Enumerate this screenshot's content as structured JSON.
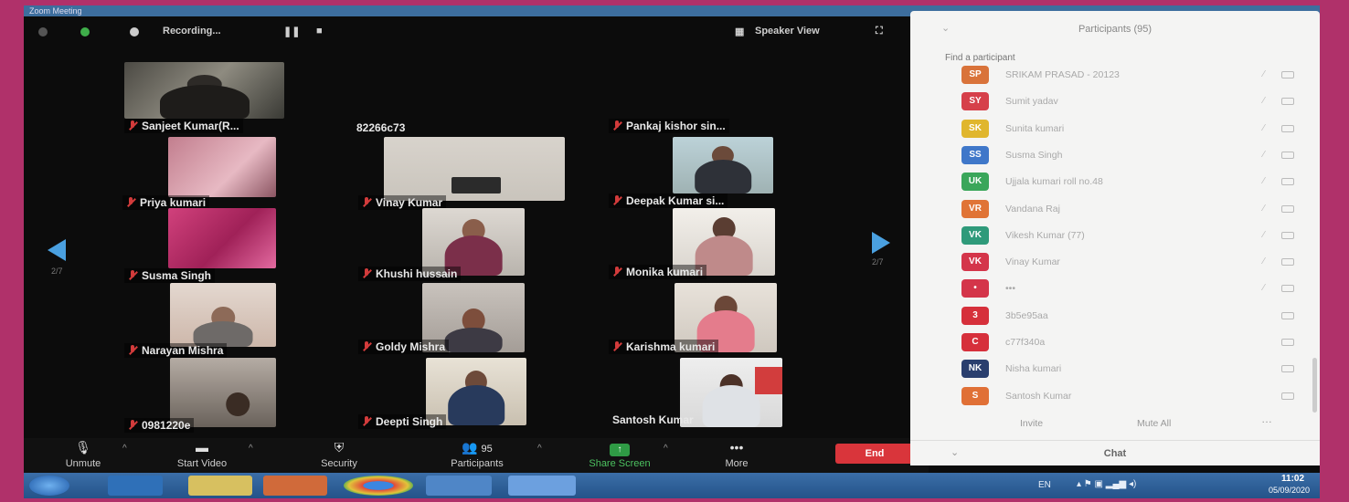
{
  "window": {
    "title": "Zoom Meeting"
  },
  "topbar": {
    "recording_label": "Recording...",
    "speaker_view_label": "Speaker View"
  },
  "gallery": {
    "page_left": "2/7",
    "page_right": "2/7",
    "tiles": [
      {
        "name": "Sanjeet Kumar(R..."
      },
      {
        "name": "82266c73"
      },
      {
        "name": "Pankaj kishor sin..."
      },
      {
        "name": "Priya kumari"
      },
      {
        "name": "Vinay Kumar"
      },
      {
        "name": "Deepak Kumar si..."
      },
      {
        "name": "Susma Singh"
      },
      {
        "name": "Khushi hussain"
      },
      {
        "name": "Monika kumari"
      },
      {
        "name": "Narayan Mishra"
      },
      {
        "name": "Goldy Mishra"
      },
      {
        "name": "Karishma kumari"
      },
      {
        "name": "0981220e"
      },
      {
        "name": "Deepti Singh"
      },
      {
        "name": "Santosh Kumar"
      }
    ]
  },
  "toolbar": {
    "unmute_label": "Unmute",
    "start_video_label": "Start Video",
    "security_label": "Security",
    "participants_label": "Participants",
    "participants_count": "95",
    "share_screen_label": "Share Screen",
    "more_label": "More",
    "end_label": "End"
  },
  "panel": {
    "title": "Participants (95)",
    "search_placeholder": "Find a participant",
    "participants": [
      {
        "initials": "SP",
        "name": "SRIKAM PRASAD - 20123",
        "color": "#d9733a"
      },
      {
        "initials": "SY",
        "name": "Sumit yadav",
        "color": "#d6404a"
      },
      {
        "initials": "SK",
        "name": "Sunita kumari",
        "color": "#e0b62d"
      },
      {
        "initials": "SS",
        "name": "Susma Singh",
        "color": "#3f77c9"
      },
      {
        "initials": "UK",
        "name": "Ujjala kumari roll no.48",
        "color": "#3aa65a"
      },
      {
        "initials": "VR",
        "name": "Vandana Raj",
        "color": "#e07436"
      },
      {
        "initials": "VK",
        "name": "Vikesh Kumar (77)",
        "color": "#2f9a7a"
      },
      {
        "initials": "VK",
        "name": "Vinay Kumar",
        "color": "#d4354a"
      },
      {
        "initials": "•",
        "name": "•••",
        "color": "#d4354a"
      },
      {
        "initials": "3",
        "name": "3b5e95aa",
        "color": "#d6303b"
      },
      {
        "initials": "C",
        "name": "c77f340a",
        "color": "#d6303b"
      },
      {
        "initials": "NK",
        "name": "Nisha kumari",
        "color": "#2a3f6e"
      },
      {
        "initials": "S",
        "name": "Santosh Kumar",
        "color": "#e07036"
      }
    ],
    "invite_label": "Invite",
    "mute_all_label": "Mute All",
    "chat_label": "Chat"
  },
  "taskbar": {
    "lang": "EN",
    "time": "11:02",
    "date": "05/09/2020"
  }
}
